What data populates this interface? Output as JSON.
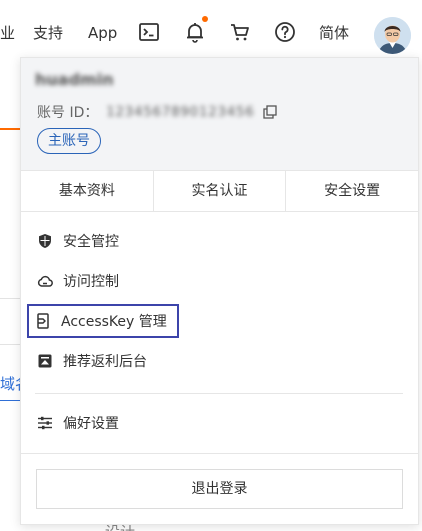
{
  "nav": {
    "partial_item": "业",
    "support": "支持",
    "app": "App",
    "language": "简体"
  },
  "background": {
    "partial_link": "域名",
    "partial_bottom": "设计"
  },
  "account": {
    "username": "huadmin",
    "id_label": "账号 ID：",
    "id_value": "1234567890123456",
    "badge": "主账号"
  },
  "tabs": [
    {
      "label": "基本资料"
    },
    {
      "label": "实名认证"
    },
    {
      "label": "安全设置"
    }
  ],
  "menu": {
    "items": [
      {
        "label": "安全管控",
        "icon": "shield-icon"
      },
      {
        "label": "访问控制",
        "icon": "cloud-icon"
      },
      {
        "label": "AccessKey 管理",
        "icon": "key-icon"
      },
      {
        "label": "推荐返利后台",
        "icon": "rebate-icon"
      },
      {
        "label": "偏好设置",
        "icon": "sliders-icon"
      }
    ],
    "logout": "退出登录"
  },
  "colors": {
    "accent_orange": "#ff6a00",
    "badge_blue": "#2a64b8",
    "highlight_border": "#3c44aa",
    "header_bg": "#f3f4f6"
  }
}
